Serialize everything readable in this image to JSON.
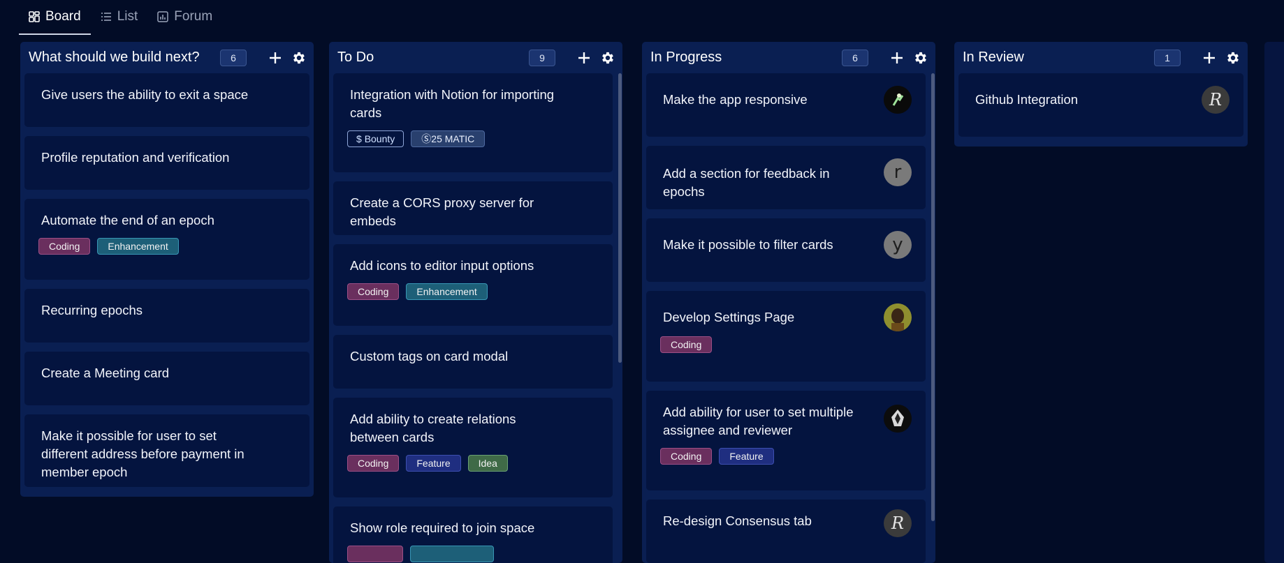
{
  "tabs": [
    {
      "label": "Board",
      "icon": "board-icon"
    },
    {
      "label": "List",
      "icon": "list-icon"
    },
    {
      "label": "Forum",
      "icon": "forum-icon"
    }
  ],
  "columns": [
    {
      "title": "What should we build next?",
      "count": "6",
      "cards": [
        {
          "title": "Give users the ability to exit a space"
        },
        {
          "title": "Profile reputation and verification"
        },
        {
          "title": "Automate the end of an epoch",
          "tags": [
            "Coding",
            "Enhancement"
          ]
        },
        {
          "title": "Recurring epochs"
        },
        {
          "title": "Create a Meeting card"
        },
        {
          "title": "Make it possible for user to set different address before payment in member epoch"
        }
      ]
    },
    {
      "title": "To Do",
      "count": "9",
      "cards": [
        {
          "title": "Integration with Notion for importing cards",
          "tags": [
            "Bounty",
            "25 MATIC"
          ]
        },
        {
          "title": "Create a CORS proxy server for embeds"
        },
        {
          "title": "Add icons to editor input options",
          "tags": [
            "Coding",
            "Enhancement"
          ]
        },
        {
          "title": "Custom tags on card modal"
        },
        {
          "title": "Add ability to create relations between cards",
          "tags": [
            "Coding",
            "Feature",
            "Idea"
          ]
        },
        {
          "title": "Show role required to join space"
        }
      ]
    },
    {
      "title": "In Progress",
      "count": "6",
      "cards": [
        {
          "title": "Make the app responsive",
          "avatar": ""
        },
        {
          "title": "Add a section for feedback in epochs",
          "avatar": "r"
        },
        {
          "title": "Make it possible to filter cards",
          "avatar": "y"
        },
        {
          "title": "Develop Settings Page",
          "tags": [
            "Coding"
          ],
          "avatar": ""
        },
        {
          "title": "Add ability for user to set multiple assignee and reviewer",
          "tags": [
            "Coding",
            "Feature"
          ],
          "avatar": ""
        },
        {
          "title": "Re-design Consensus tab",
          "avatar": "R"
        }
      ]
    },
    {
      "title": "In Review",
      "count": "1",
      "cards": [
        {
          "title": "Github Integration",
          "avatar": "R"
        }
      ]
    }
  ]
}
